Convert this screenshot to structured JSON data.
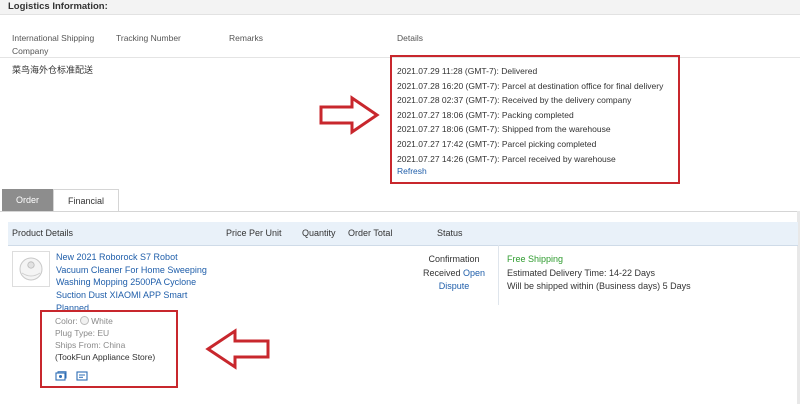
{
  "logistics": {
    "title": "Logistics Information:",
    "headers": {
      "shipping": "International Shipping Company",
      "tracking": "Tracking Number",
      "remarks": "Remarks",
      "details": "Details"
    },
    "carrier": "菜鸟海外仓标准配送",
    "events": [
      "2021.07.29 11:28 (GMT-7): Delivered",
      "2021.07.28 16:20 (GMT-7): Parcel at destination office for final delivery",
      "2021.07.28 02:37 (GMT-7): Received by the delivery company",
      "2021.07.27 18:06 (GMT-7): Packing completed",
      "2021.07.27 18:06 (GMT-7): Shipped from the warehouse",
      "2021.07.27 17:42 (GMT-7): Parcel picking completed",
      "2021.07.27 14:26 (GMT-7): Parcel received by warehouse"
    ],
    "refresh": "Refresh"
  },
  "tabs": {
    "order": "Order",
    "financial": "Financial"
  },
  "order_table": {
    "headers": {
      "details": "Product Details",
      "price": "Price Per Unit",
      "quantity": "Quantity",
      "total": "Order Total",
      "status": "Status"
    },
    "product": {
      "title_lines": [
        "New 2021 Roborock S7 Robot",
        "Vacuum Cleaner For Home Sweeping",
        "Washing Mopping 2500PA Cyclone",
        "Suction Dust XIAOMI APP Smart",
        "Planned"
      ],
      "color": "Color:",
      "color_value": "White",
      "plug": "Plug Type: EU",
      "ships_from": "Ships From: China",
      "store": "(TookFun Appliance Store)"
    },
    "status": {
      "line1": "Confirmation",
      "line2": "Received",
      "open": "Open",
      "dispute": "Dispute"
    },
    "shipping": {
      "free": "Free Shipping",
      "estimated": "Estimated Delivery Time: 14-22 Days",
      "within": "Will be shipped within (Business days) 5 Days"
    }
  },
  "colors": {
    "link": "#1f5eaa",
    "annotation": "#c8272d",
    "free_shipping": "#2f9c2f",
    "tab_active": "#8d8d8d"
  },
  "icons": [
    "arrow-right-annotation-icon",
    "arrow-left-annotation-icon",
    "robot-vacuum-thumbnail",
    "snapshot-icon",
    "receipt-icon"
  ]
}
